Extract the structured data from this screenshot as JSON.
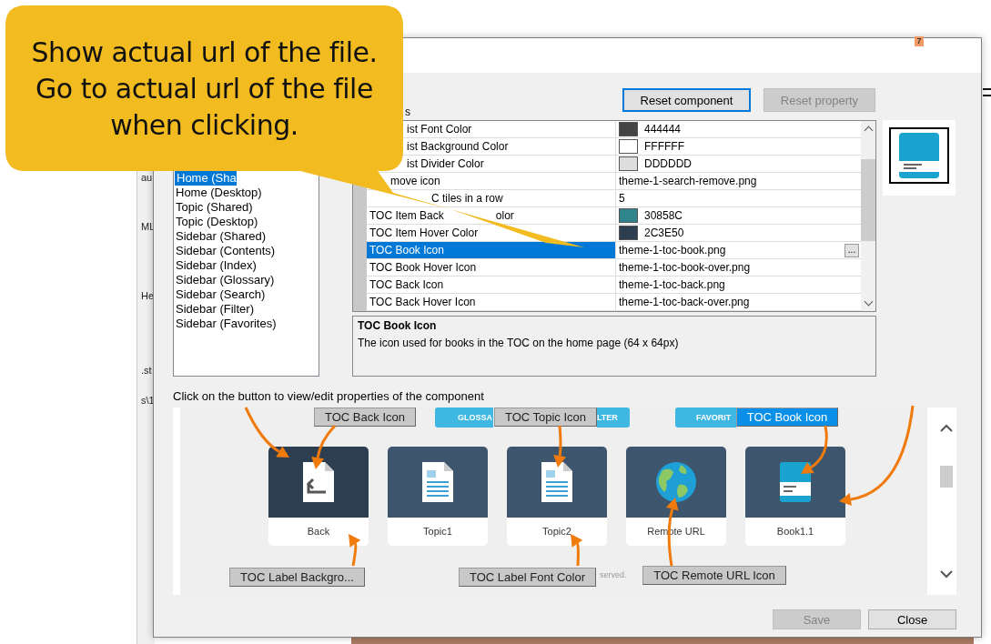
{
  "callout": {
    "text": "Show actual url of the file.\nGo to actual url of the file\nwhen clicking."
  },
  "background_window": {
    "fragments": [
      "au",
      "ML",
      "He",
      ".st",
      "s\\1"
    ]
  },
  "badge": "7",
  "dialog": {
    "header_label": "s",
    "reset_buttons": [
      {
        "label": "Reset component",
        "disabled": false,
        "focused": true
      },
      {
        "label": "Reset property",
        "disabled": true,
        "focused": false
      }
    ],
    "components": [
      {
        "label": "Home (Sha",
        "selected": true
      },
      {
        "label": "Home (Desktop)",
        "selected": false
      },
      {
        "label": "Topic (Shared)",
        "selected": false
      },
      {
        "label": "Topic (Desktop)",
        "selected": false
      },
      {
        "label": "Sidebar (Shared)",
        "selected": false
      },
      {
        "label": "Sidebar (Contents)",
        "selected": false
      },
      {
        "label": "Sidebar (Index)",
        "selected": false
      },
      {
        "label": "Sidebar (Glossary)",
        "selected": false
      },
      {
        "label": "Sidebar (Search)",
        "selected": false
      },
      {
        "label": "Sidebar (Filter)",
        "selected": false
      },
      {
        "label": "Sidebar (Favorites)",
        "selected": false
      }
    ],
    "properties": [
      {
        "name": "ist Font Color",
        "kind": "color",
        "color": "#444444",
        "value": "444444",
        "selected": false
      },
      {
        "name": "ist Background Color",
        "kind": "color",
        "color": "#ffffff",
        "value": "FFFFFF",
        "selected": false
      },
      {
        "name": "ist Divider Color",
        "kind": "color",
        "color": "#dddddd",
        "value": "DDDDDD",
        "selected": false
      },
      {
        "name": "move icon",
        "kind": "file",
        "value": "theme-1-search-remove.png",
        "selected": false
      },
      {
        "name": "C tiles in a row",
        "kind": "text",
        "value": "5",
        "selected": false
      },
      {
        "name": "TOC Item Back",
        "name_rest": "olor",
        "kind": "color",
        "color": "#30858c",
        "value": "30858C",
        "selected": false
      },
      {
        "name": "TOC Item Hover Color",
        "kind": "color",
        "color": "#2c3e50",
        "value": "2C3E50",
        "selected": false
      },
      {
        "name": "TOC Book Icon",
        "kind": "file",
        "value": "theme-1-toc-book.png",
        "selected": true,
        "button": "..."
      },
      {
        "name": "TOC Book Hover Icon",
        "kind": "file",
        "value": "theme-1-toc-book-over.png",
        "selected": false
      },
      {
        "name": "TOC Back Icon",
        "kind": "file",
        "value": "theme-1-toc-back.png",
        "selected": false
      },
      {
        "name": "TOC Back Hover Icon",
        "kind": "file",
        "value": "theme-1-toc-back-over.png",
        "selected": false
      }
    ],
    "description": {
      "title": "TOC Book Icon",
      "text": "The icon used for books in the TOC on the home page (64 x 64px)"
    },
    "caption": "Click on the button to view/edit properties of the component",
    "preview": {
      "web_buttons": [
        {
          "text": "GLOSSA"
        },
        {
          "text": "LTER"
        },
        {
          "text": "FAVORIT"
        }
      ],
      "tiles": [
        {
          "label": "Back",
          "kind": "back",
          "hover": true
        },
        {
          "label": "Topic1",
          "kind": "topic",
          "hover": false
        },
        {
          "label": "Topic2",
          "kind": "topic",
          "hover": false
        },
        {
          "label": "Remote URL",
          "kind": "globe",
          "hover": false
        },
        {
          "label": "Book1.1",
          "kind": "book",
          "hover": false
        }
      ],
      "footer_text": "served.",
      "annotations": [
        {
          "label": "TOC Back Icon",
          "selected": false
        },
        {
          "label": "TOC Topic Icon",
          "selected": false
        },
        {
          "label": "TOC Book Icon",
          "selected": true
        },
        {
          "label": "TOC Label Backgro...",
          "selected": false
        },
        {
          "label": "TOC Label Font Color",
          "selected": false
        },
        {
          "label": "TOC Remote URL Icon",
          "selected": false
        }
      ]
    },
    "footer_buttons": [
      {
        "label": "Save",
        "disabled": true
      },
      {
        "label": "Close",
        "disabled": false
      }
    ]
  }
}
